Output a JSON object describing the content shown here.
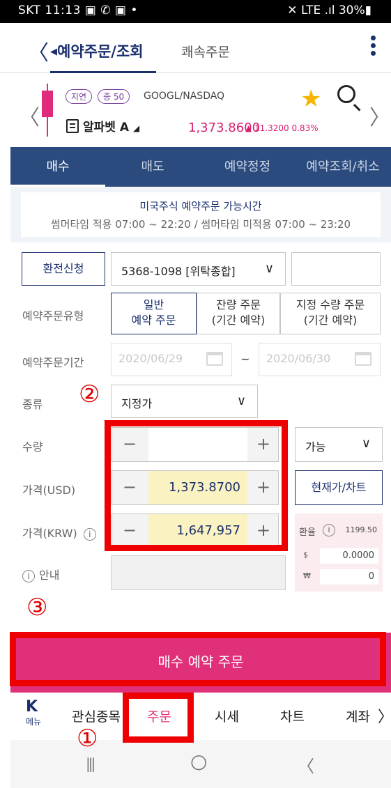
{
  "status_bar": {
    "left": "SKT 11:13 ▣ ✆ ▣ •",
    "right": "✕ LTE .ıl 30%▮"
  },
  "header": {
    "back_symbol": "〈",
    "tab_main_prefix": "◀",
    "tab_main": "예약주문/조회",
    "tab_second": "쾌속주문"
  },
  "stock": {
    "delay_badge": "지연",
    "margin_badge": "증 50",
    "ticker": "GOOGL/NASDAQ",
    "name": "알파벳 A",
    "name_suffix": "◢",
    "price": "1,373.8600",
    "change": "▲ 11.3200  0.83%",
    "star_symbol": "★"
  },
  "order_tabs": [
    "매수",
    "매도",
    "예약정정",
    "예약조회/취소"
  ],
  "notice": {
    "title": "미국주식 예약주문 가능시간",
    "hours": "썸머타임 적용 07:00 ~ 22:20 / 썸머타임 미적용 07:00 ~ 23:20"
  },
  "form": {
    "exchange_btn": "환전신청",
    "account": "5368-1098 [위탁종합]",
    "order_type_label": "예약주문유형",
    "order_types": [
      {
        "l1": "일반",
        "l2": "예약 주문"
      },
      {
        "l1": "잔량 주문",
        "l2": "(기간 예약)"
      },
      {
        "l1": "지정 수량 주문",
        "l2": "(기간 예약)"
      }
    ],
    "period_label": "예약주문기간",
    "period_start": "2020/06/29",
    "period_sep": "~",
    "period_end": "2020/06/30",
    "kind_label": "종류",
    "kind_value": "지정가",
    "qty_label": "수량",
    "qty_value": "",
    "qty_mode": "가능",
    "usd_label": "가격(USD)",
    "usd_value": "1,373.8700",
    "chart_btn": "현재가/차트",
    "krw_label": "가격(KRW)",
    "krw_value": "1,647,957",
    "info_label": "안내",
    "info_icon": "i",
    "minus": "−",
    "plus": "+"
  },
  "fx": {
    "label": "환율",
    "rate": "1199.50",
    "usd_sym": "$",
    "usd_val": "0.0000",
    "krw_sym": "₩",
    "krw_val": "0"
  },
  "annotations": {
    "one": "①",
    "two": "②",
    "three": "③"
  },
  "buy_button": "매수 예약 주문",
  "bottom_nav": {
    "logo": "K",
    "menu": "메뉴",
    "items": [
      "관심종목",
      "주문",
      "시세",
      "차트",
      "계좌"
    ],
    "more": "〉"
  },
  "system_nav": {
    "recent": "|||",
    "home": "○",
    "back": "〈"
  },
  "colors": {
    "navy": "#1a2f6d",
    "tab_bg": "#2b4b7e",
    "pink": "#e0307a",
    "red_annotation": "#ee0000",
    "star": "#f7b400"
  }
}
